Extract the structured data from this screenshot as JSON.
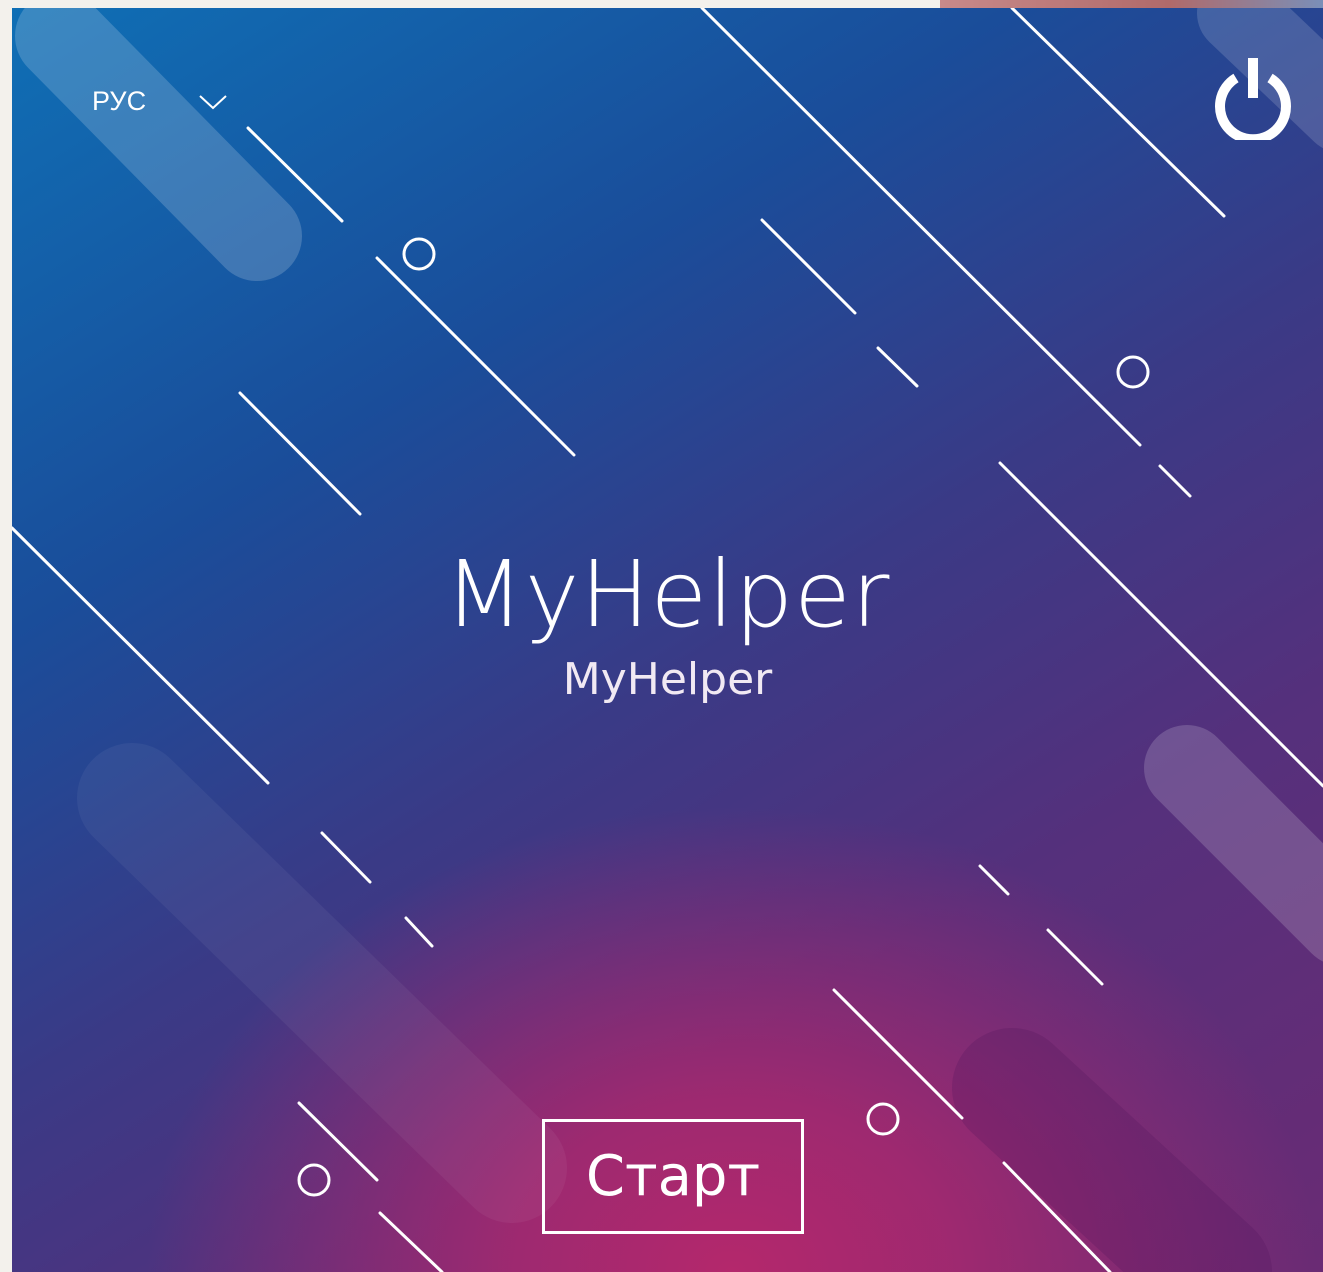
{
  "language": {
    "selected": "РУС"
  },
  "title": "MyHelper",
  "subtitle": "MyHelper",
  "start_button": {
    "label": "Старт"
  },
  "icons": {
    "language_dropdown": "chevron-down-icon",
    "power": "power-icon"
  },
  "colors": {
    "gradient_top_left": "#0f6fb5",
    "gradient_middle": "#3a3a86",
    "gradient_bottom": "#b4286c",
    "foreground": "#ffffff"
  }
}
